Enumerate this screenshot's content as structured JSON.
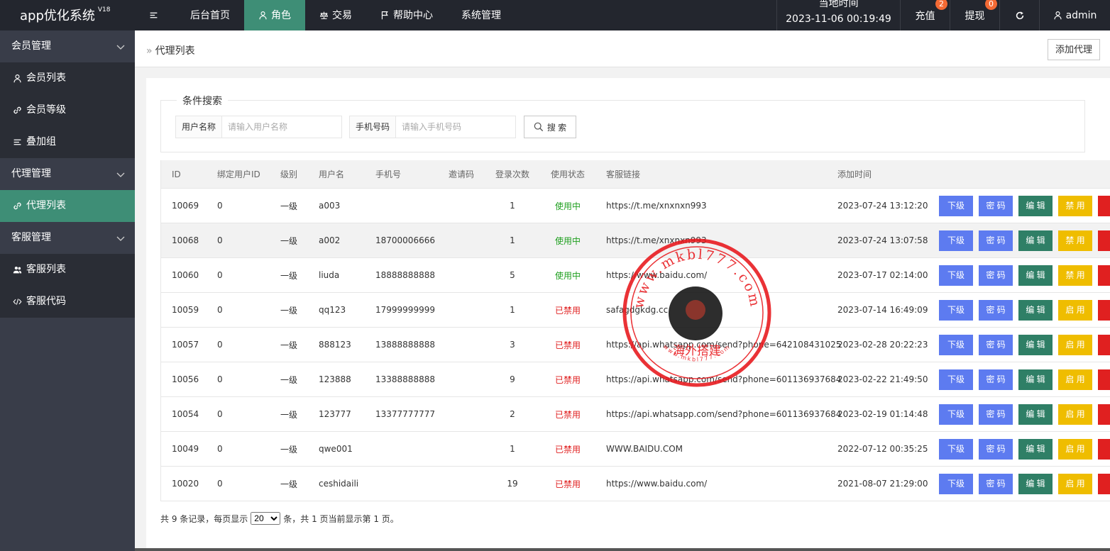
{
  "app": {
    "title": "app优化系统",
    "version": "V18"
  },
  "topnav": [
    {
      "label": "",
      "icon": "menu-icon"
    },
    {
      "label": "后台首页"
    },
    {
      "label": "角色",
      "icon": "user-icon",
      "active": true
    },
    {
      "label": "交易",
      "icon": "scale-icon"
    },
    {
      "label": "帮助中心",
      "icon": "flag-icon"
    },
    {
      "label": "系统管理"
    }
  ],
  "topright": {
    "localtime_label": "当地时间",
    "localtime_value": "2023-11-06 00:19:49",
    "recharge_label": "充值",
    "recharge_badge": "2",
    "withdraw_label": "提现",
    "withdraw_badge": "0",
    "refresh_icon": "refresh-icon",
    "admin_label": "admin"
  },
  "sidebar": [
    {
      "label": "会员管理",
      "type": "group"
    },
    {
      "label": "会员列表",
      "type": "item",
      "icon": "user-icon"
    },
    {
      "label": "会员等级",
      "type": "item",
      "icon": "link-icon"
    },
    {
      "label": "叠加组",
      "type": "item",
      "icon": "list-icon"
    },
    {
      "label": "代理管理",
      "type": "group"
    },
    {
      "label": "代理列表",
      "type": "item",
      "icon": "link-icon",
      "active": true
    },
    {
      "label": "客服管理",
      "type": "group"
    },
    {
      "label": "客服列表",
      "type": "item",
      "icon": "users-icon"
    },
    {
      "label": "客服代码",
      "type": "item",
      "icon": "code-icon"
    }
  ],
  "breadcrumb": {
    "label": "代理列表"
  },
  "add_agent_label": "添加代理",
  "search": {
    "legend": "条件搜索",
    "username_label": "用户名称",
    "username_placeholder": "请输入用户名称",
    "phone_label": "手机号码",
    "phone_placeholder": "请输入手机号码",
    "button_label": "搜 索"
  },
  "table": {
    "headers": [
      "ID",
      "绑定用户ID",
      "级别",
      "用户名",
      "手机号",
      "邀请码",
      "登录次数",
      "使用状态",
      "客服链接",
      "添加时间"
    ],
    "rows": [
      {
        "id": "10069",
        "bind": "0",
        "level": "一级",
        "user": "a003",
        "phone": "",
        "invite": "",
        "login": "1",
        "status": "使用中",
        "on": true,
        "link": "https://t.me/xnxnxn993",
        "time": "2023-07-24 13:12:20",
        "toggle": "禁 用"
      },
      {
        "id": "10068",
        "bind": "0",
        "level": "一级",
        "user": "a002",
        "phone": "18700006666",
        "invite": "",
        "login": "1",
        "status": "使用中",
        "on": true,
        "link": "https://t.me/xnxnxn993",
        "time": "2023-07-24 13:07:58",
        "toggle": "禁 用"
      },
      {
        "id": "10060",
        "bind": "0",
        "level": "一级",
        "user": "liuda",
        "phone": "18888888888",
        "invite": "",
        "login": "5",
        "status": "使用中",
        "on": true,
        "link": "https://www.baidu.com/",
        "time": "2023-07-17 02:14:00",
        "toggle": "禁 用"
      },
      {
        "id": "10059",
        "bind": "0",
        "level": "一级",
        "user": "qq123",
        "phone": "17999999999",
        "invite": "",
        "login": "1",
        "status": "已禁用",
        "on": false,
        "link": "safagdgkdg.cc",
        "time": "2023-07-14 16:49:09",
        "toggle": "启 用"
      },
      {
        "id": "10057",
        "bind": "0",
        "level": "一级",
        "user": "888123",
        "phone": "13888888888",
        "invite": "",
        "login": "3",
        "status": "已禁用",
        "on": false,
        "link": "https://api.whatsapp.com/send?phone=642108431025",
        "time": "2023-02-28 20:22:23",
        "toggle": "启 用"
      },
      {
        "id": "10056",
        "bind": "0",
        "level": "一级",
        "user": "123888",
        "phone": "13388888888",
        "invite": "",
        "login": "9",
        "status": "已禁用",
        "on": false,
        "link": "https://api.whatsapp.com/send?phone=601136937684",
        "time": "2023-02-22 21:49:50",
        "toggle": "启 用"
      },
      {
        "id": "10054",
        "bind": "0",
        "level": "一级",
        "user": "123777",
        "phone": "13377777777",
        "invite": "",
        "login": "2",
        "status": "已禁用",
        "on": false,
        "link": "https://api.whatsapp.com/send?phone=601136937684",
        "time": "2023-02-19 01:14:48",
        "toggle": "启 用"
      },
      {
        "id": "10049",
        "bind": "0",
        "level": "一级",
        "user": "qwe001",
        "phone": "",
        "invite": "",
        "login": "1",
        "status": "已禁用",
        "on": false,
        "link": "WWW.BAIDU.COM",
        "time": "2022-07-12 00:35:25",
        "toggle": "启 用"
      },
      {
        "id": "10020",
        "bind": "0",
        "level": "一级",
        "user": "ceshidaili",
        "phone": "",
        "invite": "",
        "login": "19",
        "status": "已禁用",
        "on": false,
        "link": "https://www.baidu.com/",
        "time": "2021-08-07 21:29:00",
        "toggle": "启 用"
      }
    ],
    "action_labels": {
      "sub": "下级",
      "pwd": "密 码",
      "edit": "编 辑"
    }
  },
  "pager": {
    "prefix": "共 9 条记录，每页显示",
    "page_size": "20",
    "suffix": "条，共 1 页当前显示第 1 页。"
  },
  "stamp": {
    "text_top": "www.mkbl777.com",
    "text_center": "海外搭建",
    "text_bottom": "www.mkbl777.com"
  },
  "colors": {
    "topbar": "#23262e",
    "sidebar": "#393d49",
    "accent": "#3e8e76",
    "blue": "#5d7bf0",
    "yellow": "#efbd00",
    "red": "#e02020"
  }
}
